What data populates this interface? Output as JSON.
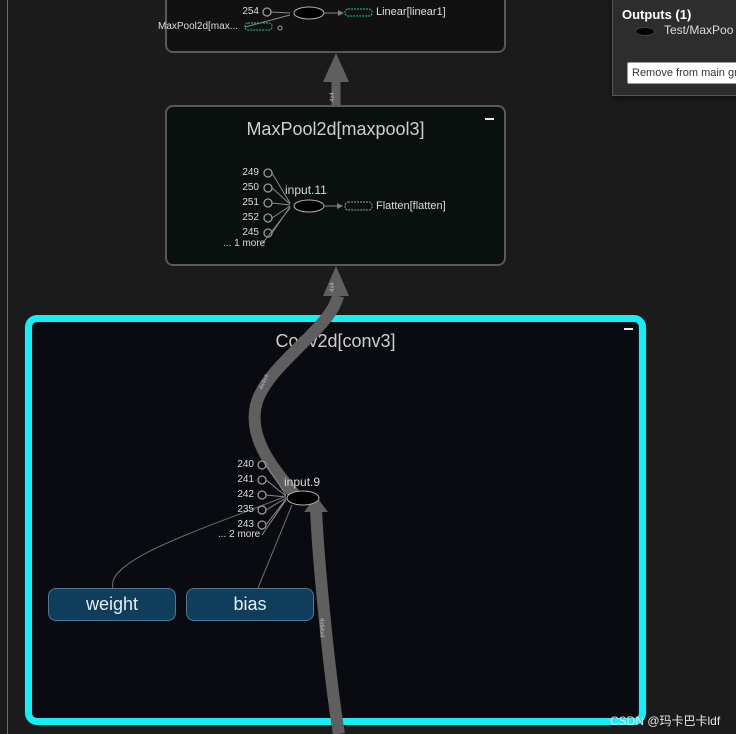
{
  "upper_box": {
    "ports": [
      "254",
      "MaxPool2d[max..."
    ],
    "target": "Linear[linear1]"
  },
  "maxpool_box": {
    "title": "MaxPool2d[maxpool3]",
    "ports": [
      "249",
      "250",
      "251",
      "252",
      "245"
    ],
    "more": "... 1 more",
    "op": "input.11",
    "target": "Flatten[flatten]"
  },
  "conv_box": {
    "title": "Conv2d[conv3]",
    "ports": [
      "240",
      "241",
      "242",
      "235",
      "243"
    ],
    "more": "... 2 more",
    "op": "input.9",
    "params": [
      "weight",
      "bias"
    ]
  },
  "side_panel": {
    "outputs_title": "Outputs (1)",
    "output_item": "Test/MaxPoo",
    "button": "Remove from main gr"
  },
  "watermark": "CSDN @玛卡巴卡ldf",
  "colors": {
    "selected_border": "#16eef7",
    "node_fill": "#0a0d10",
    "box_border": "#595959",
    "param_fill": "#0f3d5c"
  }
}
